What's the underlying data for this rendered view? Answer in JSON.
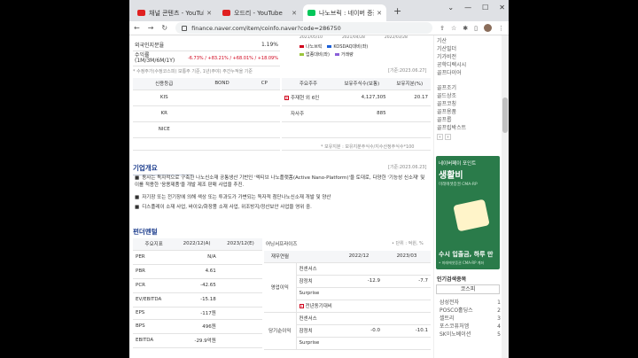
{
  "tabs": [
    {
      "title": "채널 콘텐츠 - YouTube",
      "favicon_color": "#e02020",
      "active": false
    },
    {
      "title": "오드리 - YouTube",
      "favicon_color": "#e02020",
      "active": false
    },
    {
      "title": "나노브릭 : 네이버 증권",
      "favicon_color": "#03c75a",
      "active": true
    }
  ],
  "new_tab_label": "+",
  "url": "finance.naver.com/item/coinfo.naver?code=286750",
  "top_table": {
    "rows": [
      {
        "label": "외국인지분율",
        "value": "1.19%"
      },
      {
        "label": "수익률\n(1M/3M/6M/1Y)",
        "value": "-6.73% / +83.21% / +68.01% / +18.09%"
      }
    ],
    "footnote": "* 수정주가(수정코스피) 보통주 기준, 1년(주야) 주간누적을 기준"
  },
  "mini_chart": {
    "dates": [
      "2021/05/10",
      "2021/04/28",
      "2022/03/28"
    ],
    "legend": [
      "나노브릭",
      "KOSDAQ대비(좌)",
      "업종대비(좌)",
      "거래량"
    ],
    "legend_colors": [
      "#d0021b",
      "#1a5fd8",
      "#9bc53d",
      "#8a5fd8"
    ]
  },
  "credit_table": {
    "date_note": "[기준:2023.06.27]",
    "headers": [
      "신용등급",
      "BOND",
      "CP"
    ],
    "rows": [
      "KIS",
      "KR",
      "NICE"
    ]
  },
  "holder_table": {
    "headers": [
      "주요주주",
      "보유주식수(보통)",
      "보유지분(%)"
    ],
    "rows": [
      {
        "name": "주재현 외 6인",
        "shares": "4,127,305",
        "pct": "20.17"
      },
      {
        "name": "자사주",
        "shares": "885",
        "pct": ""
      }
    ],
    "note": "* 보유지분 : 보유지분주식수/지수산정주식수*100"
  },
  "overview": {
    "title": "기업개요",
    "date_note": "[기준:2023.06.23]",
    "bullets": [
      "동사는 독자적으로 구축한 나노신소재 공통생산 기반인 '엑티브 나노플랫폼(Active Nano-Platform)'을 토대로, 다양한 '기능성 신소재' 및 이를 적용한 '응용제품'을 개발 제조 판매 사업을 추진.",
      "자기장 또는 전기장에 의해 색상 또는 투과도가 가변되는 독자적 첨단나노신소재 개발 및 양산",
      "디스플레이 소재 사업, 바이오/화장품 소재 사업, 위조방지/정산보안 사업을 영위 중."
    ]
  },
  "fundamental": {
    "title": "펀더멘털",
    "left_headers": [
      "주요지표",
      "2022/12(A)",
      "2023/12(E)"
    ],
    "left_rows": [
      {
        "label": "PER",
        "a": "N/A",
        "e": ""
      },
      {
        "label": "PBR",
        "a": "4.61",
        "e": ""
      },
      {
        "label": "PCR",
        "a": "-42.65",
        "e": ""
      },
      {
        "label": "EV/EBITDA",
        "a": "-15.18",
        "e": ""
      },
      {
        "label": "EPS",
        "a": "-117원",
        "e": ""
      },
      {
        "label": "BPS",
        "a": "496원",
        "e": ""
      },
      {
        "label": "EBITDA",
        "a": "-29.9억원",
        "e": ""
      }
    ],
    "right_title": "어닝서프라이즈",
    "right_unit": "• 단위 : 억원, %",
    "right_headers": [
      "재무연월",
      "",
      "2022/12",
      "2023/03"
    ],
    "right_groups": [
      {
        "group": "영업이익",
        "rows": [
          {
            "label": "컨센서스",
            "v1": "",
            "v2": ""
          },
          {
            "label": "잠정치",
            "v1": "-12.9",
            "v2": "-7.7"
          },
          {
            "label": "Surprise",
            "v1": "",
            "v2": ""
          },
          {
            "label": "전년동기대비",
            "v1": "",
            "v2": ""
          }
        ]
      },
      {
        "group": "당기순이익",
        "rows": [
          {
            "label": "컨센서스",
            "v1": "",
            "v2": ""
          },
          {
            "label": "잠정치",
            "v1": "-0.0",
            "v2": "-10.1"
          },
          {
            "label": "Surprise",
            "v1": "",
            "v2": ""
          }
        ]
      }
    ]
  },
  "right_panel": {
    "top_items": [
      "기산"
    ],
    "menu1": [
      "기산빌더",
      "기가비전",
      "공학디렉시시",
      "골프다이어"
    ],
    "menu2": [
      "골프조기",
      "골드상조",
      "골프코칭",
      "골프용품",
      "골프롭",
      "골프립박스트"
    ],
    "ad": {
      "line1": "네이버페이 포인트",
      "line2": "생활비",
      "line3": "미래에셋증권 CMA-RP",
      "line4": "수시 입출금, 하루 만",
      "line5": "• 미래에셋증권 CMA-RP 계좌"
    },
    "popular_title": "인기검색종목",
    "popular_tab": "코스피",
    "popular_items": [
      "삼성전자",
      "POSCO홀딩스",
      "셀트리",
      "포스코퓨처엠",
      "SK이노베이션"
    ],
    "popular_nums": [
      "1",
      "2",
      "3",
      "4",
      "5"
    ]
  }
}
